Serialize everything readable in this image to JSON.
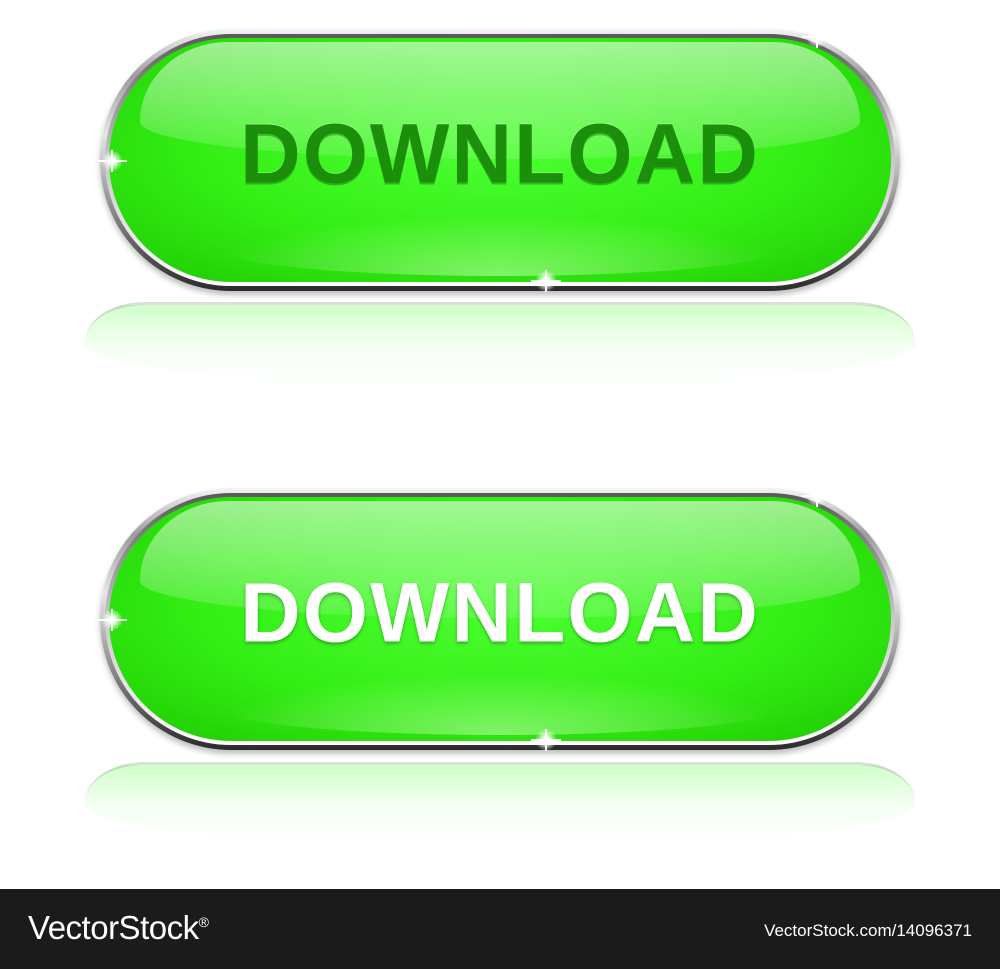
{
  "buttons": [
    {
      "label": "DOWNLOAD",
      "text_style": "dark-green-embossed",
      "face_color": "#33ee14"
    },
    {
      "label": "DOWNLOAD",
      "text_style": "white",
      "face_color": "#33ee14"
    }
  ],
  "footer": {
    "brand": "VectorStock",
    "brand_mark": "®",
    "image_id": "VectorStock.com/14096371"
  },
  "colors": {
    "button_green": "#33ee14",
    "dark_text": "#1c8f0a",
    "footer_bg": "#1b1b1b"
  }
}
